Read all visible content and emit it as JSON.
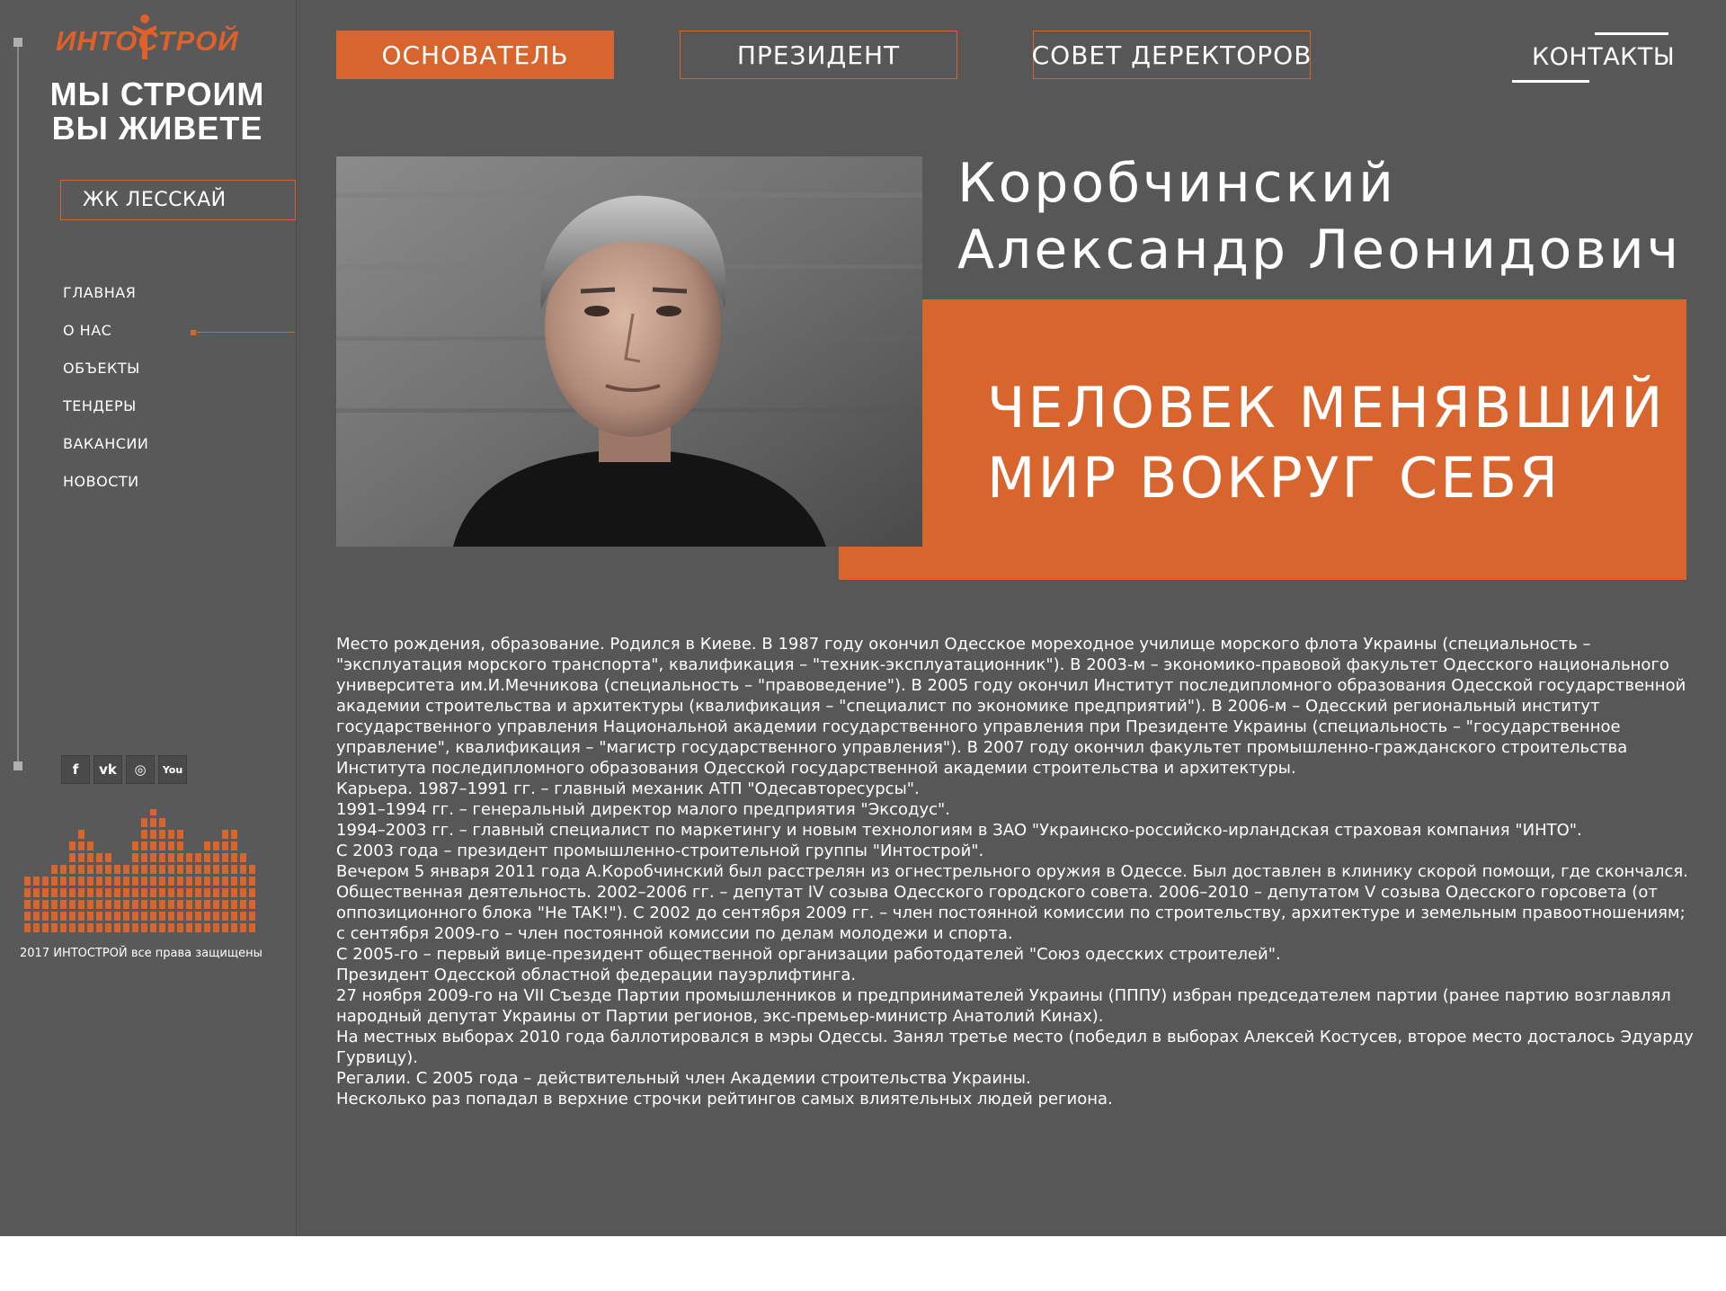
{
  "brand": {
    "logo_text": "ИНТОСТРОЙ",
    "slogan_line1": "МЫ СТРОИМ",
    "slogan_line2": "ВЫ ЖИВЕТЕ",
    "accent_color": "#d8642e",
    "background_color": "#575757"
  },
  "sidebar": {
    "project_button": "ЖК ЛЕССКАЙ",
    "nav": [
      {
        "label": "ГЛАВНАЯ"
      },
      {
        "label": "О НАС",
        "active": true
      },
      {
        "label": "ОБЪЕКТЫ"
      },
      {
        "label": "ТЕНДЕРЫ"
      },
      {
        "label": "ВАКАНСИИ"
      },
      {
        "label": "НОВОСТИ"
      }
    ],
    "social": [
      {
        "icon": "facebook-icon",
        "glyph": "f"
      },
      {
        "icon": "vk-icon",
        "glyph": "vk"
      },
      {
        "icon": "instagram-icon",
        "glyph": "◎"
      },
      {
        "icon": "youtube-icon",
        "glyph": "You"
      }
    ],
    "copyright": "2017 ИНТОСТРОЙ все права защищены"
  },
  "topnav": {
    "tabs": [
      {
        "label": "ОСНОВАТЕЛЬ",
        "active": true
      },
      {
        "label": "ПРЕЗИДЕНТ"
      },
      {
        "label": "СОВЕТ ДЕРЕКТОРОВ"
      }
    ],
    "contacts": "КОНТАКТЫ"
  },
  "hero": {
    "name_line1": "Коробчинский",
    "name_line2": "Александр Леонидович",
    "tagline_line1": "ЧЕЛОВЕК МЕНЯВШИЙ",
    "tagline_line2": "МИР ВОКРУГ СЕБЯ"
  },
  "bio": [
    "Место рождения, образование. Родился в Киеве. В 1987 году окончил Одесское мореходное училище морского флота Украины (специальность – \"эксплуатация морского транспорта\", квалификация – \"техник-эксплуатационник\"). В 2003-м – экономико-правовой факультет Одесского национального университета им.И.Мечникова (специальность – \"правоведение\"). В 2005 году окончил Институт последипломного образования Одесской государственной академии строительства и архитектуры (квалификация – \"специалист по экономике предприятий\"). В 2006-м – Одесский региональный институт государственного управления Национальной академии государственного управления при Президенте Украины (специальность – \"государственное управление\", квалификация – \"магистр государственного управления\"). В 2007 году окончил факультет промышленно-гражданского строительства Института последипломного образования Одесской государственной академии строительства и архитектуры.",
    "Карьера. 1987–1991 гг. – главный механик АТП \"Одесавторесурсы\".",
    "1991–1994 гг. – генеральный директор малого предприятия \"Эксодус\".",
    "1994–2003 гг. – главный специалист по маркетингу и новым технологиям в ЗАО \"Украинско-российско-ирландская страховая компания \"ИНТО\".",
    "С 2003 года – президент промышленно-строительной группы \"Интострой\".",
    "Вечером 5 января 2011 года А.Коробчинский был расстрелян из огнестрельного оружия в Одессе. Был доставлен в клинику скорой помощи, где скончался.",
    "Общественная деятельность. 2002–2006 гг. – депутат IV созыва Одесского городского совета. 2006–2010 – депутатом V созыва Одесского горсовета (от оппозиционного блока \"Не TAK!\"). С 2002 до сентября 2009 гг. – член постоянной комиссии по строительству, архитектуре и земельным правоотношениям; с сентября 2009-го – член постоянной комиссии по делам молодежи и спорта.",
    "С 2005-го – первый вице-президент общественной организации работодателей \"Союз одесских строителей\".",
    "Президент Одесской областной федерации пауэрлифтинга.",
    "27 ноября 2009-го на VII Съезде Партии промышленников и предпринимателей Украины (ПППУ) избран председателем партии (ранее партию возглавлял народный депутат Украины от Партии регионов, экс-премьер-министр Анатолий Кинах).",
    "На местных выборах 2010 года баллотировался в мэры Одессы. Занял третье место (победил в выборах Алексей Костусев, второе место досталось Эдуарду Гурвицу).",
    "Регалии. С 2005 года – действительный член Академии строительства Украины.",
    "Несколько раз попадал в верхние строчки рейтингов самых влиятельных людей региона."
  ]
}
